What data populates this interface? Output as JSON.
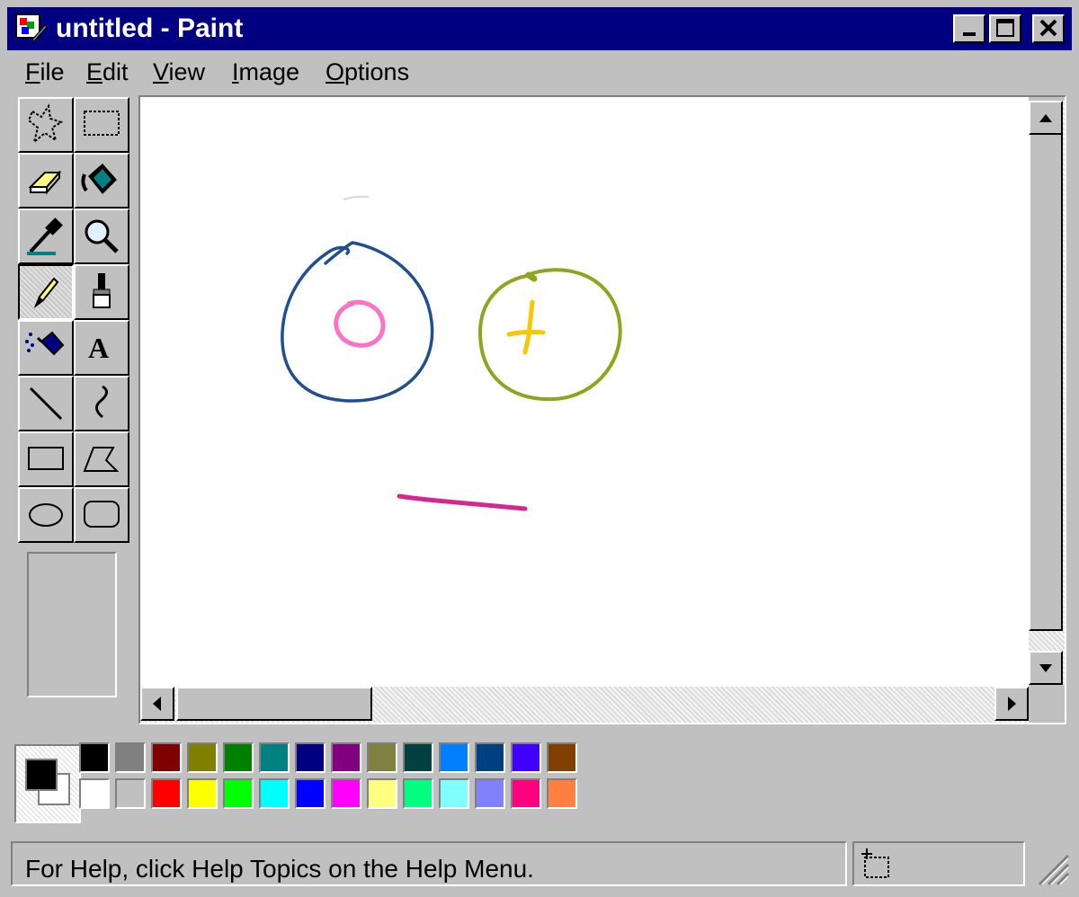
{
  "window": {
    "title": "untitled - Paint"
  },
  "menu": {
    "items": [
      {
        "first": "F",
        "rest": "ile"
      },
      {
        "first": "E",
        "rest": "dit"
      },
      {
        "first": "V",
        "rest": "iew"
      },
      {
        "first": "I",
        "rest": "mage"
      },
      {
        "first": "O",
        "rest": "ptions"
      }
    ]
  },
  "toolbox": {
    "tools": [
      "free-form-select-icon",
      "select-icon",
      "eraser-icon",
      "fill-icon",
      "pick-color-icon",
      "magnifier-icon",
      "pencil-icon",
      "brush-icon",
      "airbrush-icon",
      "text-icon",
      "line-icon",
      "curve-icon",
      "rectangle-icon",
      "polygon-icon",
      "ellipse-icon",
      "rounded-rectangle-icon"
    ],
    "selected_tool": "pencil-icon",
    "text_tool_glyph": "A"
  },
  "palette": {
    "foreground": "#000000",
    "background": "#ffffff",
    "row1": [
      "#000000",
      "#808080",
      "#800000",
      "#808000",
      "#008000",
      "#008080",
      "#000080",
      "#800080",
      "#808040",
      "#004040",
      "#0080ff",
      "#004080",
      "#4000ff",
      "#804000"
    ],
    "row2": [
      "#ffffff",
      "#c0c0c0",
      "#ff0000",
      "#ffff00",
      "#00ff00",
      "#00ffff",
      "#0000ff",
      "#ff00ff",
      "#ffff80",
      "#00ff80",
      "#80ffff",
      "#8080ff",
      "#ff0080",
      "#ff8040"
    ]
  },
  "status": {
    "help_text": "For Help, click Help Topics on the Help Menu."
  }
}
